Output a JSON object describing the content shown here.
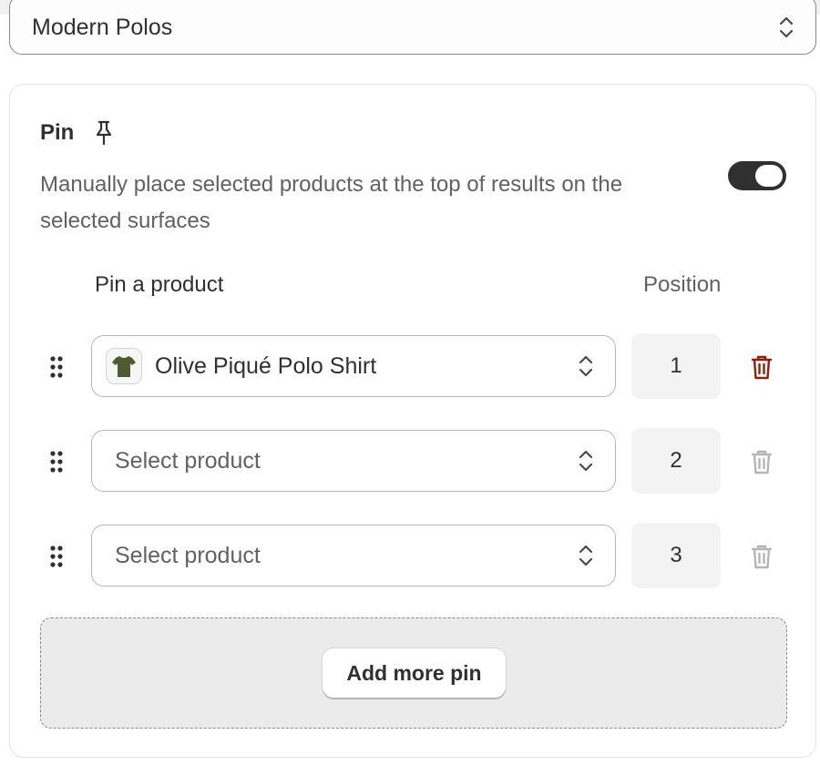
{
  "collection_select": {
    "value": "Modern Polos"
  },
  "pin_section": {
    "title": "Pin",
    "description": "Manually place selected products at the top of results on the selected surfaces",
    "toggle_on": true,
    "column_product": "Pin a product",
    "column_position": "Position",
    "rows": [
      {
        "product": "Olive Piqué Polo Shirt",
        "has_product": true,
        "position": "1",
        "delete_enabled": true
      },
      {
        "product": "Select product",
        "has_product": false,
        "position": "2",
        "delete_enabled": false
      },
      {
        "product": "Select product",
        "has_product": false,
        "position": "3",
        "delete_enabled": false
      }
    ],
    "add_more_label": "Add more pin"
  },
  "colors": {
    "delete_active": "#8e1f0b",
    "delete_disabled": "#b5b5b5",
    "toggle_on": "#303030",
    "thumbnail_shirt": "#4f5a32"
  },
  "icons": {
    "pin": "pin-icon",
    "drag": "drag-handle-icon",
    "select": "chevron-up-down-icon",
    "delete": "trash-icon"
  }
}
